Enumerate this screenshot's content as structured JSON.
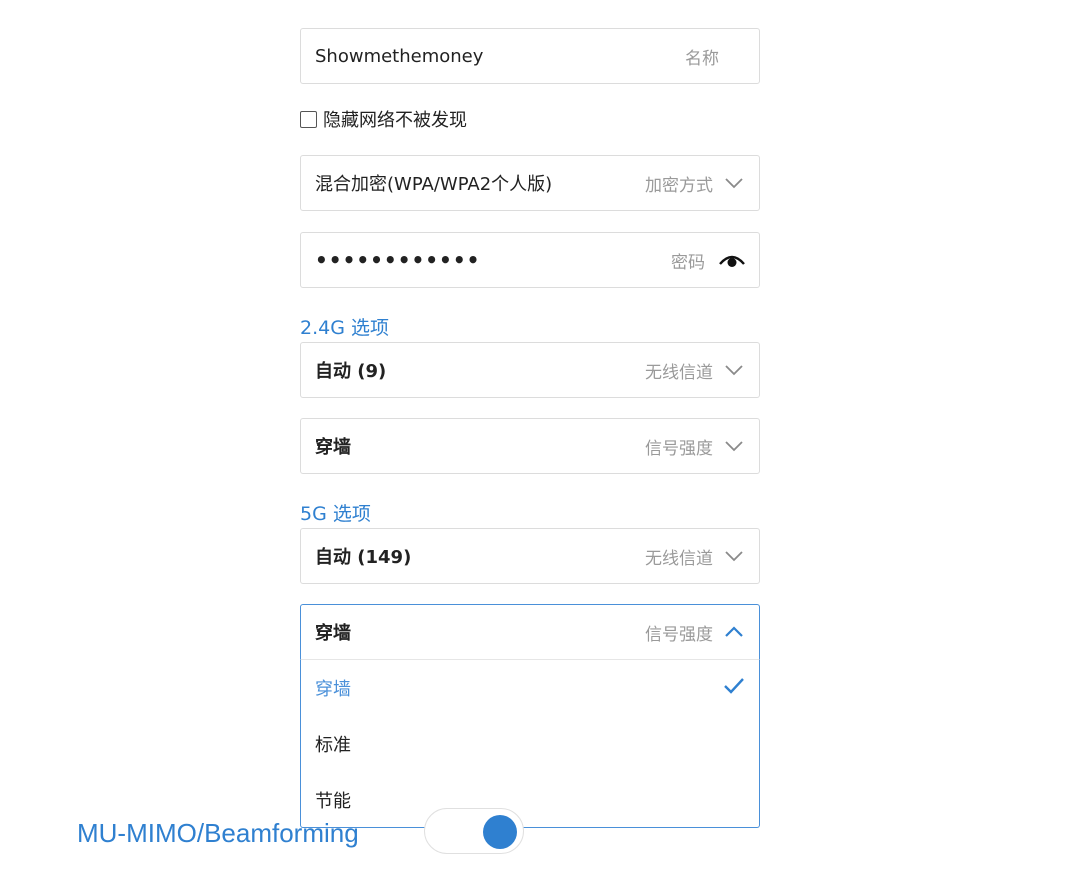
{
  "ssid": {
    "value": "Showmethemoney",
    "label": "名称"
  },
  "hidden_network": {
    "label": "隐藏网络不被发现",
    "checked": false
  },
  "encryption": {
    "value": "混合加密(WPA/WPA2个人版)",
    "label": "加密方式"
  },
  "password": {
    "masked_value": "••••••••••••",
    "label": "密码"
  },
  "band_24g": {
    "title": "2.4G 选项",
    "channel": {
      "value": "自动 (9)",
      "label": "无线信道"
    },
    "signal": {
      "value": "穿墙",
      "label": "信号强度"
    }
  },
  "band_5g": {
    "title": "5G 选项",
    "channel": {
      "value": "自动 (149)",
      "label": "无线信道"
    },
    "signal": {
      "value": "穿墙",
      "label": "信号强度",
      "options": [
        "穿墙",
        "标准",
        "节能"
      ],
      "selected_index": 0
    }
  },
  "mu_mimo": {
    "label": "MU-MIMO/Beamforming",
    "enabled": true
  },
  "colors": {
    "accent": "#2f80d0",
    "border": "#dcdcdc",
    "muted": "#9a9a9a"
  }
}
